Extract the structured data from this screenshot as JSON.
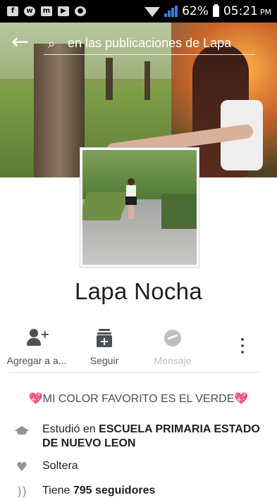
{
  "status_bar": {
    "battery": "62%",
    "time": "05:21",
    "ampm": "PM",
    "left_icons": [
      "facebook-icon",
      "whatsapp-icon",
      "messenger-icon",
      "youtube-icon",
      "camera-icon"
    ]
  },
  "header": {
    "search_placeholder": "en las publicaciones de Lapa"
  },
  "profile": {
    "name": "Lapa Nocha"
  },
  "actions": [
    {
      "label": "Agregar a a...",
      "icon": "add-friend-icon",
      "enabled": true
    },
    {
      "label": "Seguir",
      "icon": "follow-icon",
      "enabled": true
    },
    {
      "label": "Mensaje",
      "icon": "messenger-icon",
      "enabled": false
    }
  ],
  "bio": {
    "text": "MI COLOR FAVORITO ES EL VERDE",
    "accent": "#e86a8f"
  },
  "info": {
    "education_prefix": "Estudió en ",
    "education_school": "ESCUELA PRIMARIA ESTADO DE NUEVO LEON",
    "relationship": "Soltera",
    "followers_prefix": "Tiene ",
    "followers_count": "795 seguidores"
  },
  "colors": {
    "text_primary": "#1c1e21",
    "text_secondary": "#4b4f56",
    "disabled": "#bcc0c4",
    "icon_gray": "#8d949e"
  }
}
